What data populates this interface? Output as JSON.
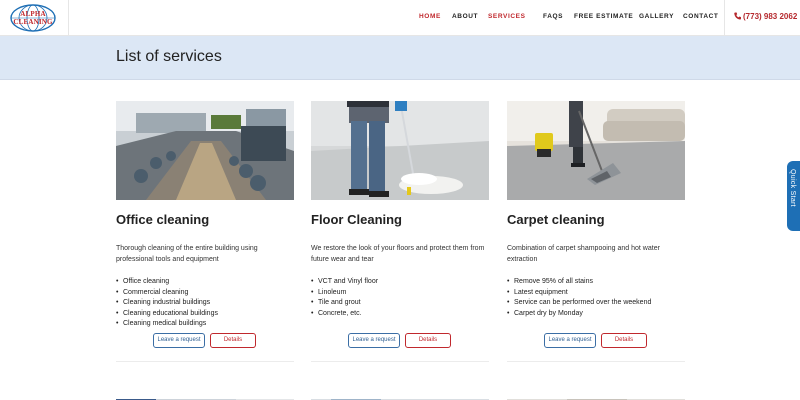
{
  "brand": {
    "logo_top": "ALPHA",
    "logo_bottom": "CLEANING"
  },
  "nav": {
    "home": "HOME",
    "about": "ABOUT",
    "services": "SERVICES",
    "faqs": "FAQS",
    "free_estimate": "FREE ESTIMATE",
    "gallery": "GALLERY",
    "contact": "CONTACT",
    "phone": "(773) 983 2062"
  },
  "page": {
    "title": "List of services"
  },
  "buttons": {
    "request": "Leave a request",
    "details": "Details"
  },
  "services": [
    {
      "title": "Office cleaning",
      "description": "Thorough cleaning of the entire building using professional tools and equipment",
      "items": [
        "Office cleaning",
        "Commercial cleaning",
        "Cleaning industrial buildings",
        "Cleaning educational buildings",
        "Cleaning medical buildings"
      ]
    },
    {
      "title": "Floor Cleaning",
      "description": "We restore the look of your floors and protect them from future wear and tear",
      "items": [
        "VCT and Vinyl floor",
        "Linoleum",
        "Tile and grout",
        "Concrete, etc."
      ]
    },
    {
      "title": "Carpet cleaning",
      "description": "Combination of carpet shampooing and hot water extraction",
      "items": [
        "Remove 95% of all stains",
        "Latest equipment",
        "Service can be performed over the weekend",
        "Carpet dry by Monday"
      ]
    }
  ],
  "quick_start": "Quick Start",
  "colors": {
    "accent_red": "#c0282d",
    "accent_blue": "#1e6fb5",
    "band": "#dce7f5"
  },
  "icons": {
    "phone": "phone-icon",
    "logo": "logo-globe-icon"
  }
}
